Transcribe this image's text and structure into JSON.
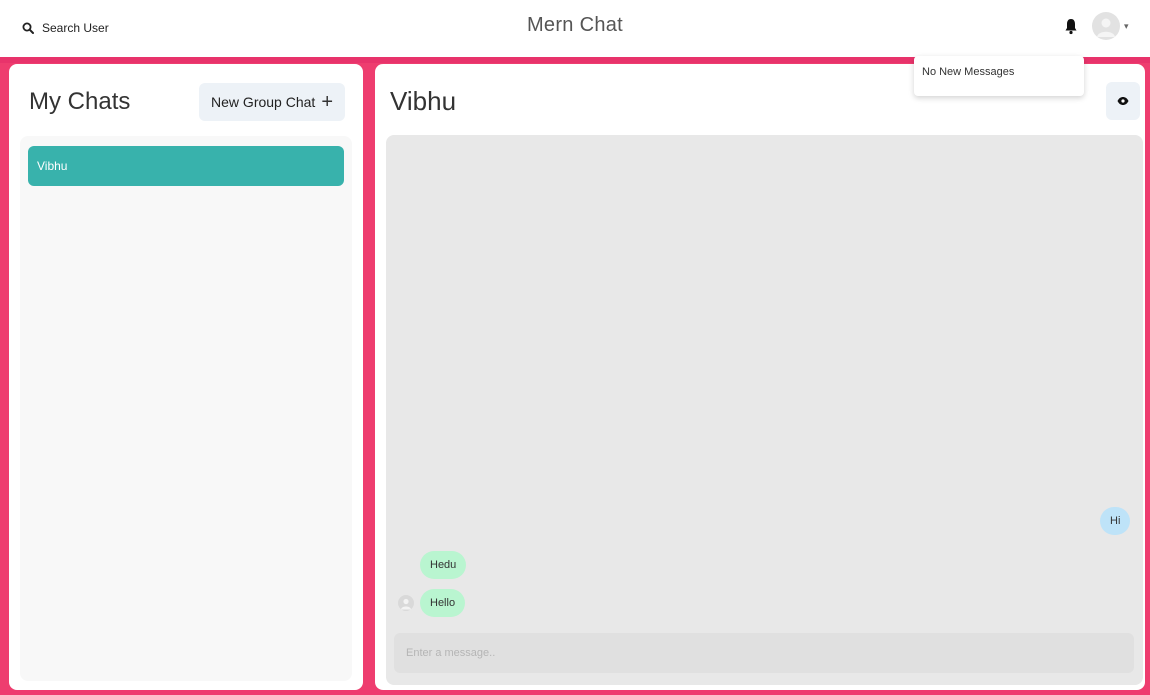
{
  "header": {
    "search_label": "Search User",
    "app_title": "Mern Chat",
    "bell_icon": "bell-icon",
    "avatar_icon": "user-avatar-icon",
    "caret_icon": "chevron-down-icon"
  },
  "notifications": {
    "empty_text": "No New Messages"
  },
  "left_panel": {
    "title": "My Chats",
    "new_group_label": "New Group Chat",
    "new_group_icon": "plus-icon",
    "chats": [
      {
        "name": "Vibhu",
        "selected": true
      }
    ]
  },
  "chat": {
    "title": "Vibhu",
    "view_profile_icon": "eye-icon",
    "messages": [
      {
        "text": "Hi",
        "sender": "me"
      },
      {
        "text": "Hedu",
        "sender": "Vibhu"
      },
      {
        "text": "Hello",
        "sender": "Vibhu"
      }
    ],
    "input_placeholder": "Enter a message.."
  },
  "colors": {
    "background": "#ee3d6f",
    "selected_chat": "#38b2ac",
    "sent_bubble": "#bee3f8",
    "received_bubble": "#b9f5d0"
  }
}
